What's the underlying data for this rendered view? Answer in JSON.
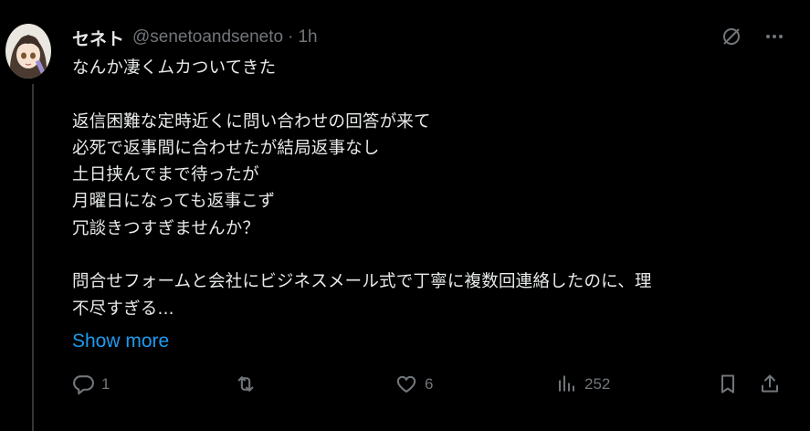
{
  "post": {
    "display_name": "セネト",
    "handle": "@senetoandseneto",
    "separator": "·",
    "time": "1h",
    "text": "なんか凄くムカついてきた\n\n返信困難な定時近くに問い合わせの回答が来て\n必死で返事間に合わせたが結局返事なし\n土日挟んでまで待ったが\n月曜日になっても返事こず\n冗談きつすぎませんか？\n\n問合せフォームと会社にビジネスメール式で丁寧に複数回連絡したのに、理\n不尽すぎる...",
    "show_more_label": "Show more"
  },
  "actions": {
    "reply_count": "1",
    "repost_count": "",
    "like_count": "6",
    "views_count": "252"
  },
  "icons": {
    "grok": "grok-icon",
    "more": "more-icon",
    "reply": "reply-icon",
    "repost": "repost-icon",
    "like": "like-icon",
    "views": "views-icon",
    "bookmark": "bookmark-icon",
    "share": "share-icon"
  },
  "colors": {
    "background": "#000000",
    "text": "#e7e9ea",
    "muted": "#71767b",
    "link": "#1d9bf0"
  }
}
